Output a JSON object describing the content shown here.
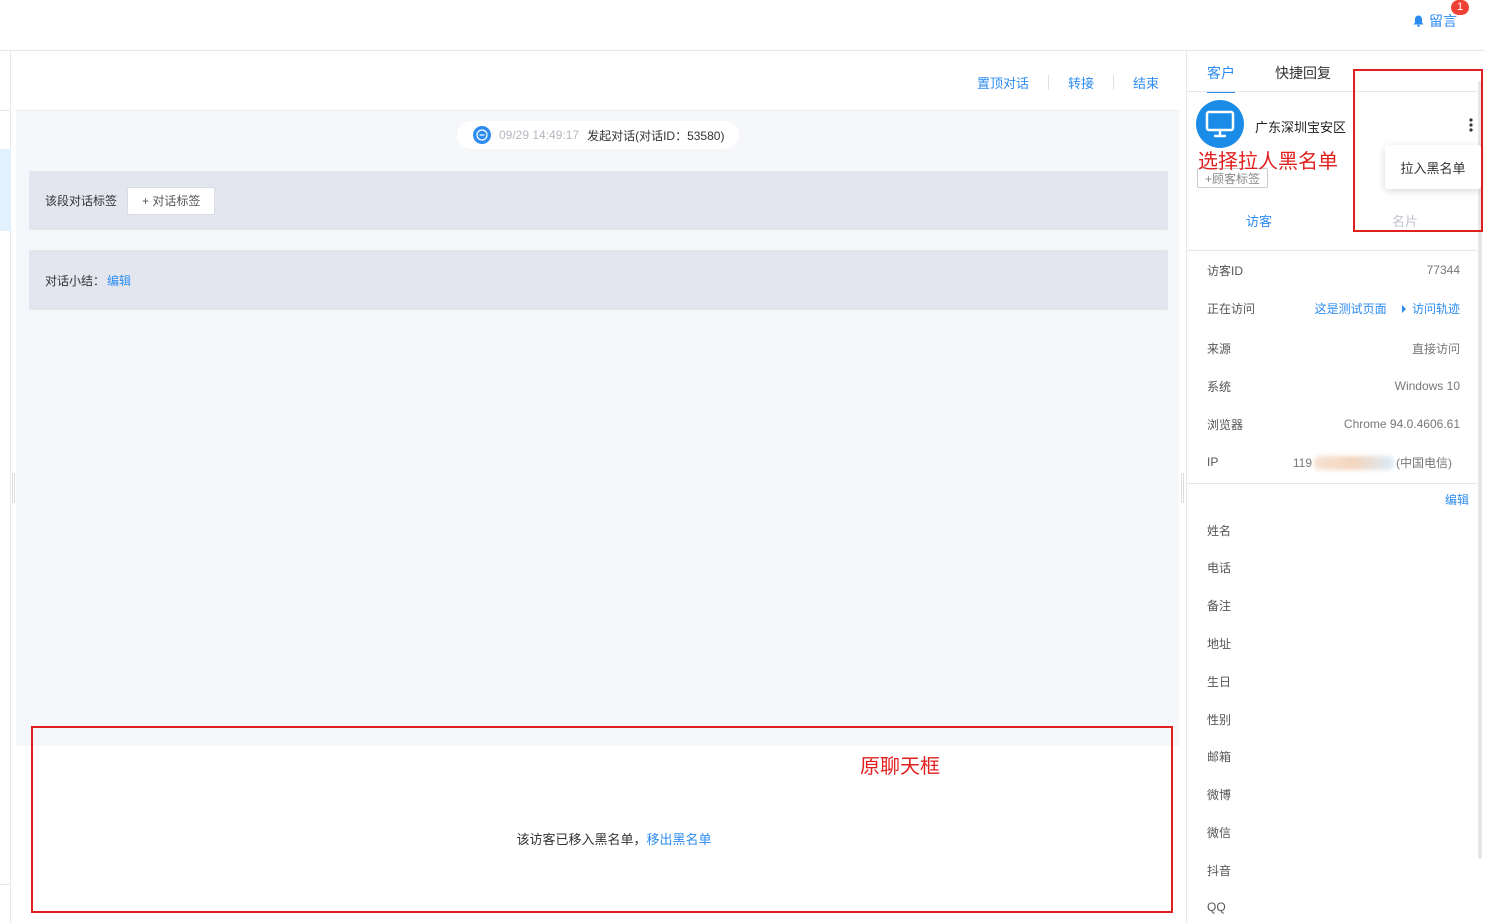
{
  "topbar": {
    "message_label": "留言",
    "message_badge": "1"
  },
  "chat": {
    "actions": [
      "置顶对话",
      "转接",
      "结束"
    ],
    "system_message": {
      "time": "09/29 14:49:17",
      "text": "发起对话(对话ID：53580)"
    },
    "tag_label": "该段对话标签",
    "tag_button": "+ 对话标签",
    "summary_label": "对话小结：",
    "summary_edit": "编辑",
    "blacklist_note": "该访客已移入黑名单，",
    "remove_blacklist": "移出黑名单"
  },
  "annotations": {
    "select_blacklist": "选择拉人黑名单",
    "original_chat": "原聊天框"
  },
  "right_panel": {
    "tabs": [
      "客户",
      "快捷回复"
    ],
    "location": "广东深圳宝安区",
    "guest_tag_button": "+顾客标签",
    "dropdown_item": "拉入黑名单",
    "sub_tabs": [
      "访客",
      "名片"
    ],
    "info": [
      {
        "key": "访客ID",
        "value": "77344"
      },
      {
        "key": "正在访问",
        "value": "这是测试页面",
        "extra": "访问轨迹"
      },
      {
        "key": "来源",
        "value": "直接访问"
      },
      {
        "key": "系统",
        "value": "Windows 10"
      },
      {
        "key": "浏览器",
        "value": "Chrome 94.0.4606.61"
      },
      {
        "key": "IP",
        "value_prefix": "119",
        "value_suffix": "(中国电信)"
      }
    ],
    "edit": "编辑",
    "fields": [
      "姓名",
      "电话",
      "备注",
      "地址",
      "生日",
      "性别",
      "邮箱",
      "微博",
      "微信",
      "抖音",
      "QQ"
    ]
  },
  "colors": {
    "accent": "#2d8cf0",
    "annotation": "#e0201f",
    "panel": "#e3e6ef"
  }
}
